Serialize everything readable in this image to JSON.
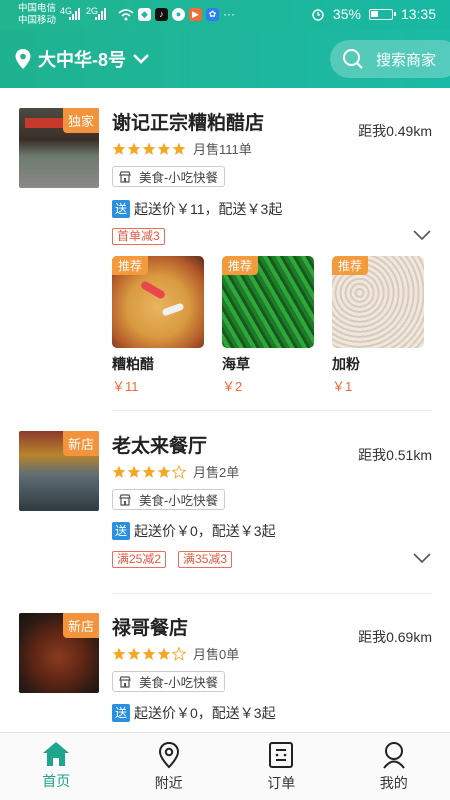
{
  "status": {
    "carrier1": "中国电信",
    "carrier2": "中国移动",
    "sig1": "4G",
    "sig2": "2G",
    "battery": "35%",
    "time": "13:35",
    "more": "···"
  },
  "header": {
    "location": "大中华-8号",
    "search_placeholder": "搜索商家"
  },
  "shops": [
    {
      "badge": "独家",
      "name": "谢记正宗糟粕醋店",
      "distance": "距我0.49km",
      "stars": 5,
      "sales": "月售111单",
      "category": "美食-小吃快餐",
      "delivery_tag": "送",
      "delivery": "起送价￥11，配送￥3起",
      "promos": [
        "首单减3"
      ],
      "dishes": [
        {
          "tag": "推荐",
          "name": "糟粕醋",
          "price": "￥11"
        },
        {
          "tag": "推荐",
          "name": "海草",
          "price": "￥2"
        },
        {
          "tag": "推荐",
          "name": "加粉",
          "price": "￥1"
        }
      ]
    },
    {
      "badge": "新店",
      "name": "老太来餐厅",
      "distance": "距我0.51km",
      "stars": 4,
      "sales": "月售2单",
      "category": "美食-小吃快餐",
      "delivery_tag": "送",
      "delivery": "起送价￥0，配送￥3起",
      "promos": [
        "满25减2",
        "满35减3"
      ]
    },
    {
      "badge": "新店",
      "name": "禄哥餐店",
      "distance": "距我0.69km",
      "stars": 4,
      "sales": "月售0单",
      "category": "美食-小吃快餐",
      "delivery_tag": "送",
      "delivery": "起送价￥0，配送￥3起"
    }
  ],
  "nav": [
    {
      "label": "首页",
      "active": true
    },
    {
      "label": "附近",
      "active": false
    },
    {
      "label": "订单",
      "active": false
    },
    {
      "label": "我的",
      "active": false
    }
  ],
  "colors": {
    "primary": "#1fb28f",
    "badge": "#f3933b",
    "star": "#f5a623",
    "price": "#f06a3a",
    "promo": "#e05a44",
    "delivery_tag": "#2a90e0"
  }
}
